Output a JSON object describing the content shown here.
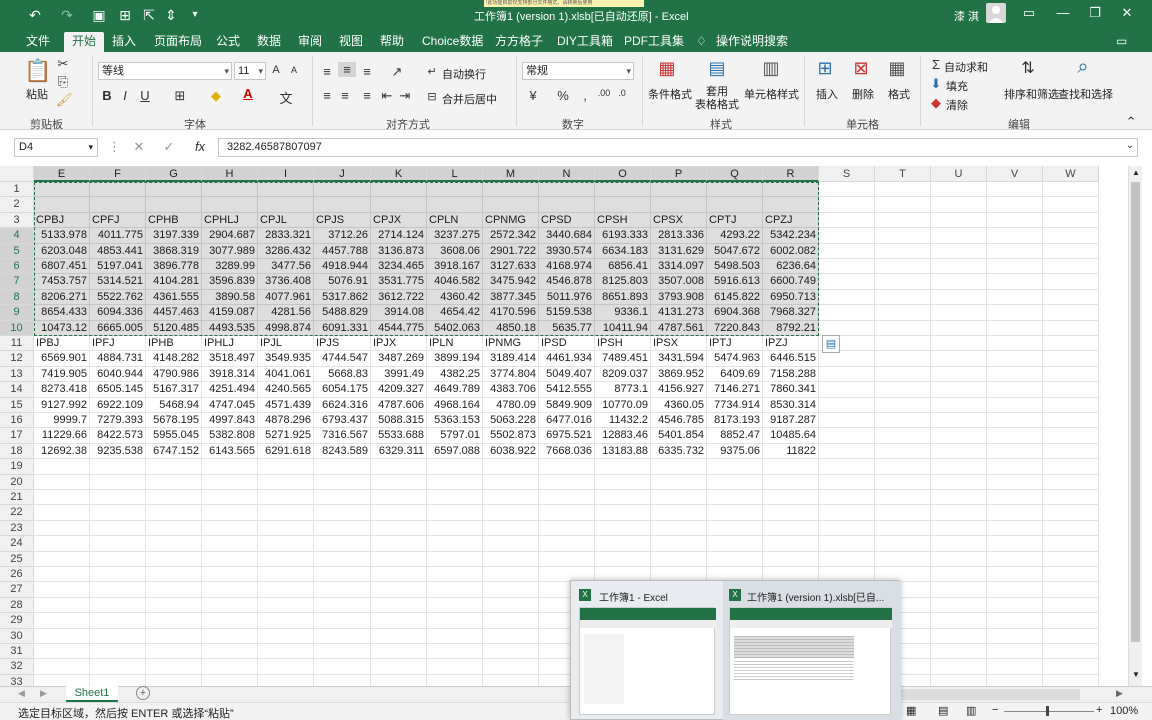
{
  "window": {
    "title": "工作簿1 (version 1).xlsb[已自动还原] - Excel",
    "warning": "!此功能目前仅支持部分文件格式，请转换后使用",
    "user": "漆 淇"
  },
  "ribbon_tabs": [
    "文件",
    "开始",
    "插入",
    "页面布局",
    "公式",
    "数据",
    "审阅",
    "视图",
    "帮助",
    "Choice数据",
    "方方格子",
    "DIY工具箱",
    "PDF工具集"
  ],
  "active_tab": "开始",
  "tell_me": "操作说明搜索",
  "ribbon": {
    "clipboard": {
      "paste": "粘贴",
      "label": "剪贴板"
    },
    "font": {
      "name": "等线",
      "size": "11",
      "label": "字体",
      "bold": "B",
      "italic": "I",
      "underline": "U"
    },
    "alignment": {
      "wrap": "自动换行",
      "merge": "合并后居中",
      "label": "对齐方式"
    },
    "number": {
      "format": "常规",
      "label": "数字",
      "percent": "%"
    },
    "styles": {
      "conditional": "条件格式",
      "table": "套用\n表格格式",
      "cell_styles": "单元格样式",
      "label": "样式"
    },
    "cells": {
      "insert": "插入",
      "delete": "删除",
      "format": "格式",
      "label": "单元格"
    },
    "editing": {
      "autosum": "自动求和",
      "fill": "填充",
      "clear": "清除",
      "sort": "排序和筛选",
      "find": "查找和选择",
      "label": "编辑"
    }
  },
  "formula_bar": {
    "name_box": "D4",
    "fx": "fx",
    "value": "3282.46587807097"
  },
  "columns": [
    "E",
    "F",
    "G",
    "H",
    "I",
    "J",
    "K",
    "L",
    "M",
    "N",
    "O",
    "P",
    "Q",
    "R",
    "S",
    "T",
    "U",
    "V",
    "W"
  ],
  "selected_columns": [
    "E",
    "F",
    "G",
    "H",
    "I",
    "J",
    "K",
    "L",
    "M",
    "N",
    "O",
    "P",
    "Q",
    "R"
  ],
  "rows": [
    [
      "",
      "",
      "",
      "",
      "",
      "",
      "",
      "",
      "",
      "",
      "",
      "",
      "",
      ""
    ],
    [
      "",
      "",
      "",
      "",
      "",
      "",
      "",
      "",
      "",
      "",
      "",
      "",
      "",
      ""
    ],
    [
      "CPBJ",
      "CPFJ",
      "CPHB",
      "CPHLJ",
      "CPJL",
      "CPJS",
      "CPJX",
      "CPLN",
      "CPNMG",
      "CPSD",
      "CPSH",
      "CPSX",
      "CPTJ",
      "CPZJ"
    ],
    [
      "5133.978",
      "4011.775",
      "3197.339",
      "2904.687",
      "2833.321",
      "3712.26",
      "2714.124",
      "3237.275",
      "2572.342",
      "3440.684",
      "6193.333",
      "2813.336",
      "4293.22",
      "5342.234"
    ],
    [
      "6203.048",
      "4853.441",
      "3868.319",
      "3077.989",
      "3286.432",
      "4457.788",
      "3136.873",
      "3608.06",
      "2901.722",
      "3930.574",
      "6634.183",
      "3131.629",
      "5047.672",
      "6002.082"
    ],
    [
      "6807.451",
      "5197.041",
      "3896.778",
      "3289.99",
      "3477.56",
      "4918.944",
      "3234.465",
      "3918.167",
      "3127.633",
      "4168.974",
      "6856.41",
      "3314.097",
      "5498.503",
      "6236.64"
    ],
    [
      "7453.757",
      "5314.521",
      "4104.281",
      "3596.839",
      "3736.408",
      "5076.91",
      "3531.775",
      "4046.582",
      "3475.942",
      "4546.878",
      "8125.803",
      "3507.008",
      "5916.613",
      "6600.749"
    ],
    [
      "8206.271",
      "5522.762",
      "4361.555",
      "3890.58",
      "4077.961",
      "5317.862",
      "3612.722",
      "4360.42",
      "3877.345",
      "5011.976",
      "8651.893",
      "3793.908",
      "6145.822",
      "6950.713"
    ],
    [
      "8654.433",
      "6094.336",
      "4457.463",
      "4159.087",
      "4281.56",
      "5488.829",
      "3914.08",
      "4654.42",
      "4170.596",
      "5159.538",
      "9336.1",
      "4131.273",
      "6904.368",
      "7968.327"
    ],
    [
      "10473.12",
      "6665.005",
      "5120.485",
      "4493.535",
      "4998.874",
      "6091.331",
      "4544.775",
      "5402.063",
      "4850.18",
      "5635.77",
      "10411.94",
      "4787.561",
      "7220.843",
      "8792.21"
    ],
    [
      "IPBJ",
      "IPFJ",
      "IPHB",
      "IPHLJ",
      "IPJL",
      "IPJS",
      "IPJX",
      "IPLN",
      "IPNMG",
      "IPSD",
      "IPSH",
      "IPSX",
      "IPTJ",
      "IPZJ"
    ],
    [
      "6569.901",
      "4884.731",
      "4148.282",
      "3518.497",
      "3549.935",
      "4744.547",
      "3487.269",
      "3899.194",
      "3189.414",
      "4461.934",
      "7489.451",
      "3431.594",
      "5474.963",
      "6446.515"
    ],
    [
      "7419.905",
      "6040.944",
      "4790.986",
      "3918.314",
      "4041.061",
      "5668.83",
      "3991.49",
      "4382.25",
      "3774.804",
      "5049.407",
      "8209.037",
      "3869.952",
      "6409.69",
      "7158.288"
    ],
    [
      "8273.418",
      "6505.145",
      "5167.317",
      "4251.494",
      "4240.565",
      "6054.175",
      "4209.327",
      "4649.789",
      "4383.706",
      "5412.555",
      "8773.1",
      "4156.927",
      "7146.271",
      "7860.341"
    ],
    [
      "9127.992",
      "6922.109",
      "5468.94",
      "4747.045",
      "4571.439",
      "6624.316",
      "4787.606",
      "4968.164",
      "4780.09",
      "5849.909",
      "10770.09",
      "4360.05",
      "7734.914",
      "8530.314"
    ],
    [
      "9999.7",
      "7279.393",
      "5678.195",
      "4997.843",
      "4878.296",
      "6793.437",
      "5088.315",
      "5363.153",
      "5063.228",
      "6477.016",
      "11432.2",
      "4546.785",
      "8173.193",
      "9187.287"
    ],
    [
      "11229.66",
      "8422.573",
      "5955.045",
      "5382.808",
      "5271.925",
      "7316.567",
      "5533.688",
      "5797.01",
      "5502.873",
      "6975.521",
      "12883.46",
      "5401.854",
      "8852.47",
      "10485.64"
    ],
    [
      "12692.38",
      "9235.538",
      "6747.152",
      "6143.565",
      "6291.618",
      "8243.589",
      "6329.311",
      "6597.088",
      "6038.922",
      "7668.036",
      "13183.88",
      "6335.732",
      "9375.06",
      "11822"
    ]
  ],
  "row_count": 33,
  "sheet_tab": "Sheet1",
  "status_text": "选定目标区域，然后按 ENTER 或选择“粘贴”",
  "zoom": "100%",
  "taskbar_preview": {
    "item1": "工作簿1 - Excel",
    "item2": "工作簿1 (version 1).xlsb[已自..."
  },
  "colors": {
    "accent": "#217346"
  }
}
